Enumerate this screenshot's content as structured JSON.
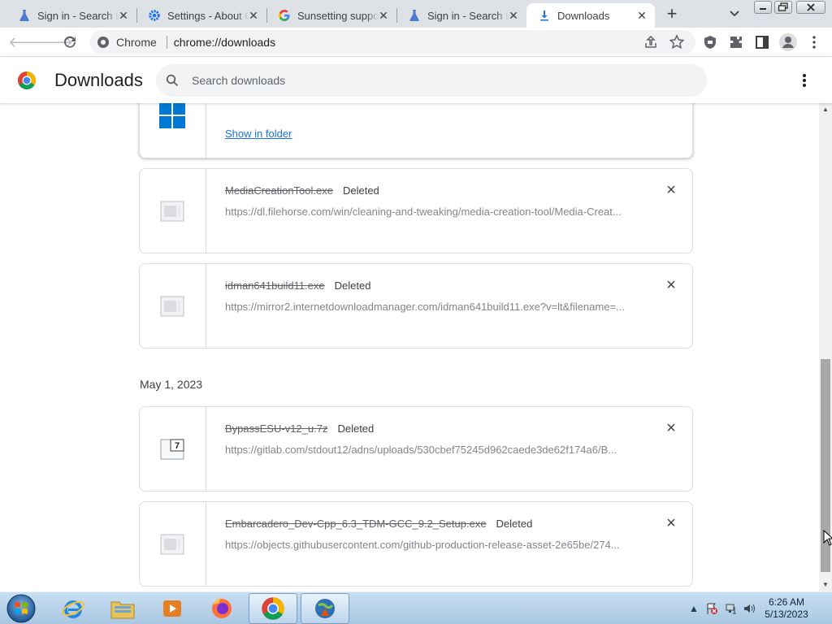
{
  "browser": {
    "tabs": [
      {
        "title": "Sign in - Search Labs",
        "icon": "flask-icon",
        "active": false
      },
      {
        "title": "Settings - About Chrome",
        "icon": "gear-icon",
        "active": false
      },
      {
        "title": "Sunsetting support",
        "icon": "google-g-icon",
        "active": false
      },
      {
        "title": "Sign in - Search Labs",
        "icon": "flask-icon",
        "active": false
      },
      {
        "title": "Downloads",
        "icon": "download-icon",
        "active": true
      }
    ],
    "omnibox": {
      "chip": "Chrome",
      "url": "chrome://downloads"
    }
  },
  "downloads": {
    "title": "Downloads",
    "search_placeholder": "Search downloads",
    "first_card": {
      "action": "Show in folder",
      "icon": "windows-logo-icon"
    },
    "items": [
      {
        "name": "MediaCreationTool.exe",
        "status": "Deleted",
        "url": "https://dl.filehorse.com/win/cleaning-and-tweaking/media-creation-tool/Media-Creat...",
        "icon": "generic-file-icon"
      },
      {
        "name": "idman641build11.exe",
        "status": "Deleted",
        "url": "https://mirror2.internetdownloadmanager.com/idman641build11.exe?v=lt&filename=...",
        "icon": "generic-file-icon"
      }
    ],
    "date_group": "May 1, 2023",
    "items_group2": [
      {
        "name": "BypassESU-v12_u.7z",
        "status": "Deleted",
        "url": "https://gitlab.com/stdout12/adns/uploads/530cbef75245d962caede3de62f174a6/B...",
        "icon": "7zip-file-icon"
      },
      {
        "name": "Embarcadero_Dev-Cpp_6.3_TDM-GCC_9.2_Setup.exe",
        "status": "Deleted",
        "url": "https://objects.githubusercontent.com/github-production-release-asset-2e65be/274...",
        "icon": "generic-file-icon"
      }
    ]
  },
  "taskbar": {
    "apps": [
      "internet-explorer-icon",
      "file-explorer-icon",
      "media-player-icon",
      "firefox-icon",
      "chrome-icon",
      "globe-app-icon"
    ],
    "time": "6:26 AM",
    "date": "5/13/2023"
  }
}
